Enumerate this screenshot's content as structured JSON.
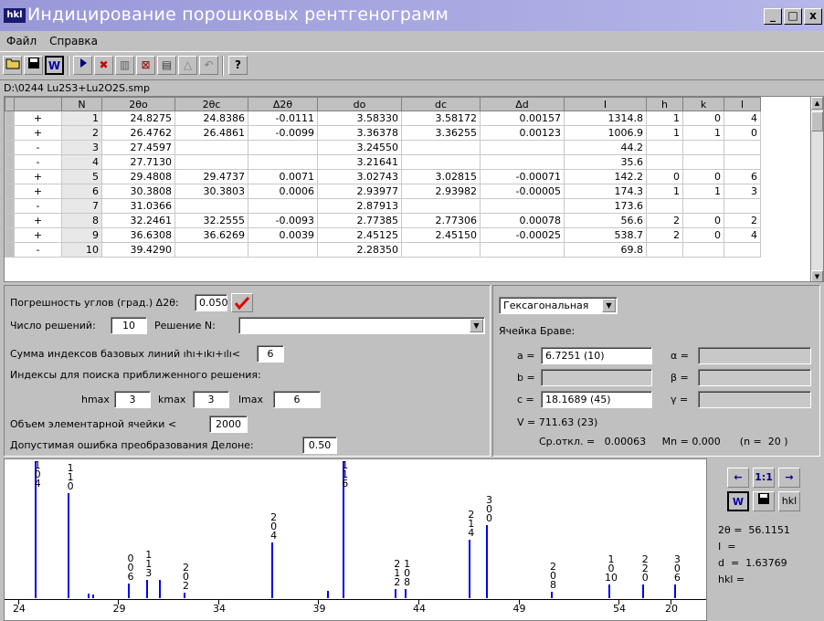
{
  "window": {
    "icon_text": "hkl",
    "title": "Индицирование порошковых рентгенограмм",
    "btn_min": "_",
    "btn_max": "□",
    "btn_close": "x"
  },
  "menu": {
    "file": "Файл",
    "help": "Справка"
  },
  "file_path": "D:\\0244 Lu2S3+Lu2O2S.smp",
  "table": {
    "headers": [
      "",
      "N",
      "2θo",
      "2θc",
      "Δ2θ",
      "do",
      "dc",
      "Δd",
      "I",
      "h",
      "k",
      "l"
    ],
    "rows": [
      [
        "+",
        "1",
        "24.8275",
        "24.8386",
        "-0.0111",
        "3.58330",
        "3.58172",
        "0.00157",
        "1314.8",
        "1",
        "0",
        "4"
      ],
      [
        "+",
        "2",
        "26.4762",
        "26.4861",
        "-0.0099",
        "3.36378",
        "3.36255",
        "0.00123",
        "1006.9",
        "1",
        "1",
        "0"
      ],
      [
        "-",
        "3",
        "27.4597",
        "",
        "",
        "3.24550",
        "",
        "",
        "44.2",
        "",
        "",
        ""
      ],
      [
        "-",
        "4",
        "27.7130",
        "",
        "",
        "3.21641",
        "",
        "",
        "35.6",
        "",
        "",
        ""
      ],
      [
        "+",
        "5",
        "29.4808",
        "29.4737",
        "0.0071",
        "3.02743",
        "3.02815",
        "-0.00071",
        "142.2",
        "0",
        "0",
        "6"
      ],
      [
        "+",
        "6",
        "30.3808",
        "30.3803",
        "0.0006",
        "2.93977",
        "2.93982",
        "-0.00005",
        "174.3",
        "1",
        "1",
        "3"
      ],
      [
        "-",
        "7",
        "31.0366",
        "",
        "",
        "2.87913",
        "",
        "",
        "173.6",
        "",
        "",
        ""
      ],
      [
        "+",
        "8",
        "32.2461",
        "32.2555",
        "-0.0093",
        "2.77385",
        "2.77306",
        "0.00078",
        "56.6",
        "2",
        "0",
        "2"
      ],
      [
        "+",
        "9",
        "36.6308",
        "36.6269",
        "0.0039",
        "2.45125",
        "2.45150",
        "-0.00025",
        "538.7",
        "2",
        "0",
        "4"
      ],
      [
        "-",
        "10",
        "39.4290",
        "",
        "",
        "2.28350",
        "",
        "",
        "69.8",
        "",
        "",
        ""
      ]
    ]
  },
  "params": {
    "err_label": "Погрешность углов (град.)  Δ2θ:",
    "err_value": "0.050",
    "solutions_label": "Число решений:",
    "solutions_value": "10",
    "solution_n_label": "Решение N:",
    "solution_n_value": "",
    "sum_label": "Сумма индексов базовых линий  ıhı+ıkı+ılı<",
    "sum_value": "6",
    "indices_label": "Индексы для поиска приближенного решения:",
    "hmax_label": "hmax",
    "hmax_value": "3",
    "kmax_label": "kmax",
    "kmax_value": "3",
    "lmax_label": "lmax",
    "lmax_value": "6",
    "volume_label": "Объем элементарной ячейки <",
    "volume_value": "2000",
    "delone_label": "Допустимая ошибка преобразования Делоне:",
    "delone_value": "0.50"
  },
  "cell": {
    "system": "Гексагональная",
    "bravais_label": "Ячейка Браве:",
    "a_label": "a =",
    "a_value": "6.7251  (10)",
    "b_label": "b =",
    "b_value": "",
    "c_label": "c =",
    "c_value": "18.1689  (45)",
    "alpha_label": "α =",
    "beta_label": "β =",
    "gamma_label": "γ =",
    "volume_line": "V = 711.63  (23)",
    "stats_line": "Ср.откл. =   0.00063     Mn = 0.000      (n =  20 )"
  },
  "graph": {
    "x_ticks": [
      "24",
      "29",
      "34",
      "39",
      "44",
      "49",
      "54",
      "20"
    ],
    "peaks": [
      {
        "x": 24.8275,
        "intensity": 1314.8,
        "label": [
          "1",
          "0",
          "4"
        ]
      },
      {
        "x": 26.4762,
        "intensity": 1006.9,
        "label": [
          "1",
          "1",
          "0"
        ]
      },
      {
        "x": 27.4597,
        "intensity": 44.2,
        "label": []
      },
      {
        "x": 27.713,
        "intensity": 35.6,
        "label": []
      },
      {
        "x": 29.4808,
        "intensity": 142.2,
        "label": [
          "0",
          "0",
          "6"
        ]
      },
      {
        "x": 30.3808,
        "intensity": 174.3,
        "label": [
          "1",
          "1",
          "3"
        ]
      },
      {
        "x": 31.0366,
        "intensity": 173.6,
        "label": []
      },
      {
        "x": 32.2461,
        "intensity": 56.6,
        "label": [
          "2",
          "0",
          "2"
        ]
      },
      {
        "x": 36.6308,
        "intensity": 538.7,
        "label": [
          "2",
          "0",
          "4"
        ]
      },
      {
        "x": 39.429,
        "intensity": 69.8,
        "label": []
      },
      {
        "x": 40.2,
        "intensity": 1314.8,
        "label": [
          "1",
          "1",
          "6"
        ]
      },
      {
        "x": 42.8,
        "intensity": 90,
        "label": [
          "2",
          "1",
          "2"
        ]
      },
      {
        "x": 43.3,
        "intensity": 90,
        "label": [
          "1",
          "0",
          "8"
        ]
      },
      {
        "x": 46.5,
        "intensity": 560,
        "label": [
          "2",
          "1",
          "4"
        ]
      },
      {
        "x": 47.4,
        "intensity": 700,
        "label": [
          "3",
          "0",
          "0"
        ]
      },
      {
        "x": 50.6,
        "intensity": 60,
        "label": [
          "2",
          "0",
          "8"
        ]
      },
      {
        "x": 53.5,
        "intensity": 130,
        "label": [
          "1",
          "0",
          "10"
        ]
      },
      {
        "x": 55.2,
        "intensity": 130,
        "label": [
          "2",
          "2",
          "0"
        ]
      },
      {
        "x": 56.8,
        "intensity": 130,
        "label": [
          "3",
          "0",
          "6"
        ]
      }
    ]
  },
  "side": {
    "zoom_label": "1:1",
    "hkl_btn": "hkl",
    "theta_line": "2θ =  56.1151",
    "i_line": "I  =",
    "d_line": "d  =  1.63769",
    "hkl_line": "hkl ="
  }
}
